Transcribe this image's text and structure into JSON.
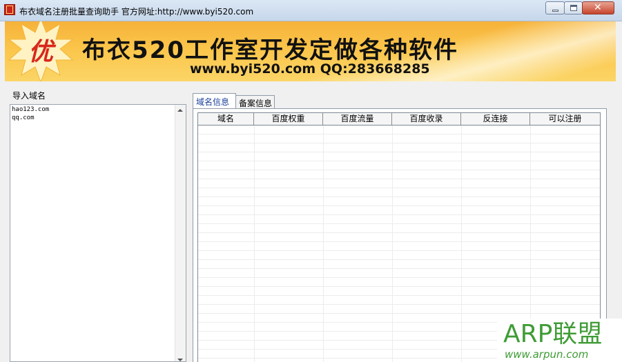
{
  "window": {
    "title": "布衣域名注册批量查询助手  官方网址:http://www.byi520.com",
    "close_glyph": "✕"
  },
  "banner": {
    "logo_text": "优",
    "headline": "布衣520工作室开发定做各种软件",
    "contact": "www.byi520.com QQ:283668285"
  },
  "left_pane": {
    "import_label": "导入域名",
    "domains": [
      "hao123.com",
      "qq.com"
    ]
  },
  "tabs": [
    {
      "label": "域名信息",
      "selected": true
    },
    {
      "label": "备案信息",
      "selected": false
    }
  ],
  "grid": {
    "columns": [
      "域名",
      "百度权重",
      "百度流量",
      "百度收录",
      "反连接",
      "可以注册"
    ],
    "rows": []
  },
  "watermark": {
    "title": "ARP联盟",
    "url": "www.arpun.com"
  },
  "colors": {
    "banner_orange": "#fbc54a",
    "watermark_green": "#3f9c35",
    "tab_active_text": "#1a3f9a",
    "logo_red": "#d8281b"
  }
}
